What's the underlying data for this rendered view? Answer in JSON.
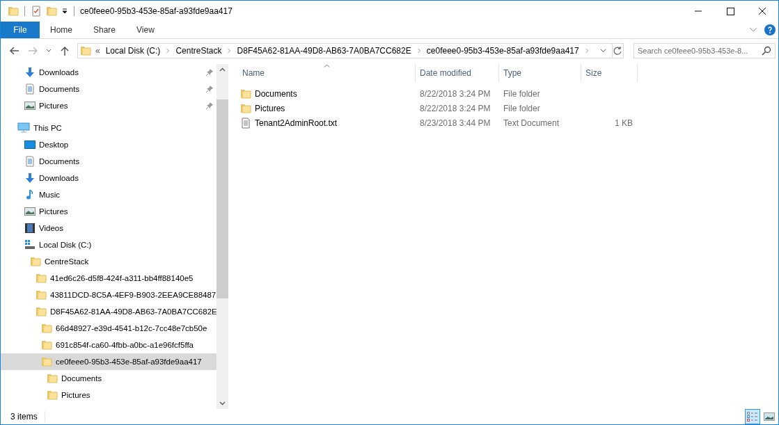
{
  "window": {
    "title": "ce0feee0-95b3-453e-85af-a93fde9aa417"
  },
  "ribbon": {
    "file_tab": "File",
    "tabs": [
      "Home",
      "Share",
      "View"
    ]
  },
  "address_bar": {
    "overflow": "«",
    "segments": [
      "Local Disk (C:)",
      "CentreStack",
      "D8F45A62-81AA-49D8-AB63-7A0BA7CC682E",
      "ce0feee0-95b3-453e-85af-a93fde9aa417"
    ]
  },
  "search": {
    "placeholder": "Search ce0feee0-95b3-453e-8..."
  },
  "navigation": {
    "quick_access": [
      {
        "label": "Downloads",
        "kind": "downloads",
        "pinned": true
      },
      {
        "label": "Documents",
        "kind": "documents",
        "pinned": true
      },
      {
        "label": "Pictures",
        "kind": "pictures",
        "pinned": true
      }
    ],
    "tree": [
      {
        "label": "This PC",
        "kind": "pc",
        "selected": false,
        "children": [
          {
            "label": "Desktop",
            "kind": "desktop",
            "selected": false
          },
          {
            "label": "Documents",
            "kind": "documents",
            "selected": false
          },
          {
            "label": "Downloads",
            "kind": "downloads",
            "selected": false
          },
          {
            "label": "Music",
            "kind": "music",
            "selected": false
          },
          {
            "label": "Pictures",
            "kind": "pictures",
            "selected": false
          },
          {
            "label": "Videos",
            "kind": "videos",
            "selected": false
          },
          {
            "label": "Local Disk (C:)",
            "kind": "drive",
            "selected": false,
            "children": [
              {
                "label": "CentreStack",
                "kind": "folder",
                "selected": false,
                "children": [
                  {
                    "label": "41ed6c26-d5f8-424f-a311-bb4ff88140e5",
                    "kind": "folder",
                    "selected": false
                  },
                  {
                    "label": "43811DCD-8C5A-4EF9-B903-2EEA9CE88487",
                    "kind": "folder",
                    "selected": false
                  },
                  {
                    "label": "D8F45A62-81AA-49D8-AB63-7A0BA7CC682E",
                    "kind": "folder",
                    "selected": false,
                    "children": [
                      {
                        "label": "66d48927-e39d-4541-b12c-7cc48e7cb50e",
                        "kind": "folder",
                        "selected": false
                      },
                      {
                        "label": "691c854f-ca60-4fbb-a0bc-a1e96fcf5ffa",
                        "kind": "folder",
                        "selected": false
                      },
                      {
                        "label": "ce0feee0-95b3-453e-85af-a93fde9aa417",
                        "kind": "folder",
                        "selected": true,
                        "children": [
                          {
                            "label": "Documents",
                            "kind": "folder",
                            "selected": false
                          },
                          {
                            "label": "Pictures",
                            "kind": "folder",
                            "selected": false
                          }
                        ]
                      }
                    ]
                  }
                ]
              }
            ]
          }
        ]
      }
    ]
  },
  "file_list": {
    "columns": [
      {
        "label": "Name",
        "sorted": true
      },
      {
        "label": "Date modified",
        "sorted": false
      },
      {
        "label": "Type",
        "sorted": false
      },
      {
        "label": "Size",
        "sorted": false
      }
    ],
    "rows": [
      {
        "name": "Documents",
        "kind": "folder",
        "date": "8/22/2018 3:24 PM",
        "type": "File folder"
      },
      {
        "name": "Pictures",
        "kind": "folder",
        "date": "8/22/2018 3:24 PM",
        "type": "File folder"
      },
      {
        "name": "Tenant2AdminRoot.txt",
        "kind": "text",
        "date": "8/23/2018 3:44 PM",
        "type": "Text Document",
        "size": "1 KB"
      }
    ]
  },
  "status_bar": {
    "item_count": "3 items",
    "views": [
      {
        "kind": "details",
        "selected": true
      },
      {
        "kind": "thumbnails",
        "selected": false
      }
    ]
  }
}
